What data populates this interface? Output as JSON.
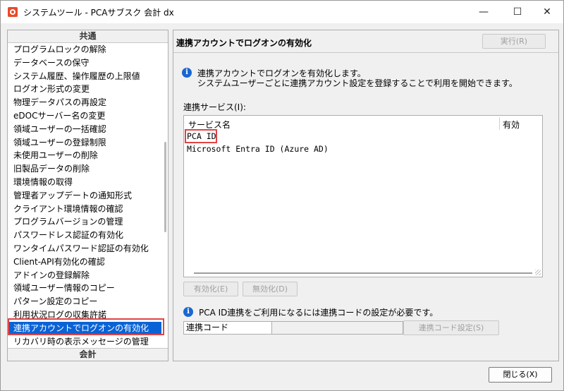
{
  "window": {
    "title": "システムツール - PCAサブスク 会計 dx",
    "minimize_glyph": "—",
    "maximize_glyph": "☐",
    "close_glyph": "✕"
  },
  "sidebar": {
    "top_group": "共通",
    "bottom_group": "会計",
    "items": [
      "プログラムロックの解除",
      "データベースの保守",
      "システム履歴、操作履歴の上限値",
      "ログオン形式の変更",
      "物理データパスの再設定",
      "eDOCサーバー名の変更",
      "領域ユーザーの一括確認",
      "領域ユーザーの登録制限",
      "未使用ユーザーの削除",
      "旧製品データの削除",
      "環境情報の取得",
      "管理者アップデートの通知形式",
      "クライアント環境情報の確認",
      "プログラムバージョンの管理",
      "パスワードレス認証の有効化",
      "ワンタイムパスワード認証の有効化",
      "Client-API有効化の確認",
      "アドインの登録解除",
      "領域ユーザー情報のコピー",
      "パターン設定のコピー",
      "利用状況ログの収集許諾",
      "連携アカウントでログオンの有効化",
      "リカバリ時の表示メッセージの管理"
    ],
    "selected_index": 21
  },
  "main": {
    "title": "連携アカウントでログオンの有効化",
    "execute_button": "実行(R)",
    "info_line1": "連携アカウントでログオンを有効化します。",
    "info_line2": "システムユーザーごとに連携アカウント設定を登録することで利用を開始できます。",
    "services_label": "連携サービス(I):",
    "columns": {
      "name": "サービス名",
      "enabled": "有効"
    },
    "services": [
      {
        "name": "PCA ID",
        "enabled": ""
      },
      {
        "name": "Microsoft Entra ID (Azure AD)",
        "enabled": ""
      }
    ],
    "enable_button": "有効化(E)",
    "disable_button": "無効化(D)",
    "notice": "PCA ID連携をご利用になるには連携コードの設定が必要です。",
    "code_label": "連携コード",
    "code_value": "",
    "code_settings_button": "連携コード設定(S)"
  },
  "footer": {
    "close_button": "閉じる(X)"
  },
  "colors": {
    "selection": "#0a63d6",
    "highlight_border": "#e04444",
    "info_icon": "#1967d2"
  }
}
